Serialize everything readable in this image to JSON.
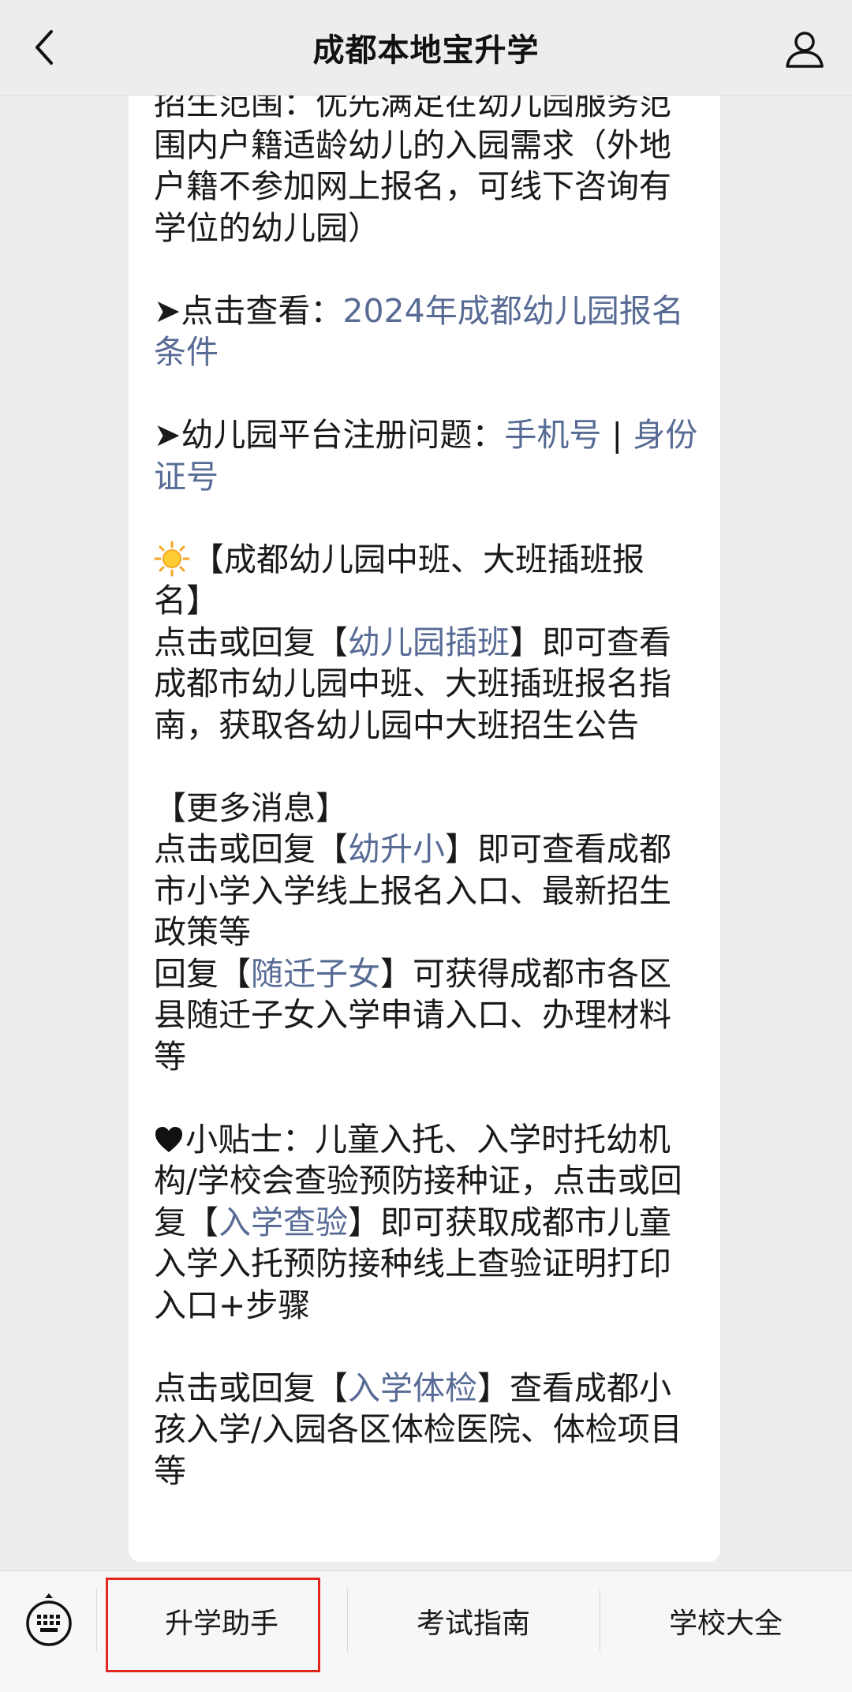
{
  "header": {
    "title": "成都本地宝升学",
    "back_icon": "chevron-left-icon",
    "profile_icon": "user-icon"
  },
  "article": {
    "p1": "招生范围：优先满足在幼儿园服务范围内户籍适龄幼儿的入园需求（外地户籍不参加网上报名，可线下咨询有学位的幼儿园）",
    "p2_prefix": "➤点击查看：",
    "p2_link": "2024年成都幼儿园报名条件",
    "p3_prefix": "➤幼儿园平台注册问题：",
    "p3_link1": "手机号",
    "p3_sep": " | ",
    "p3_link2": "身份证号",
    "p4_title": "【成都幼儿园中班、大班插班报名】",
    "p4_pre": "点击或回复【",
    "p4_link": "幼儿园插班",
    "p4_post": "】即可查看成都市幼儿园中班、大班插班报名指南，获取各幼儿园中大班招生公告",
    "p5_title": "【更多消息】",
    "p5_pre": "点击或回复【",
    "p5_link": "幼升小",
    "p5_post": "】即可查看成都市小学入学线上报名入口、最新招生政策等",
    "p6_pre": "回复【",
    "p6_link": "随迁子女",
    "p6_post": "】可获得成都市各区县随迁子女入学申请入口、办理材料等",
    "p7_pre": "小贴士：儿童入托、入学时托幼机构/学校会查验预防接种证，点击或回复【",
    "p7_link": "入学查验",
    "p7_post": "】即可获取成都市儿童入学入托预防接种线上查验证明打印入口+步骤",
    "p8_pre": "点击或回复【",
    "p8_link": "入学体检",
    "p8_post": "】查看成都小孩入学/入园各区体检医院、体检项目等"
  },
  "icons": {
    "sun": "sun-emoji-icon",
    "heart": "black-heart-icon",
    "keyboard": "keyboard-icon"
  },
  "tabbar": {
    "tabs": [
      "升学助手",
      "考试指南",
      "学校大全"
    ],
    "highlighted_tab": "升学助手"
  },
  "colors": {
    "link": "#576b95",
    "highlight_border": "#e0261d",
    "background": "#ededed"
  }
}
